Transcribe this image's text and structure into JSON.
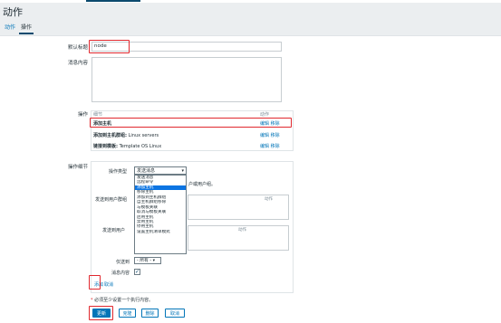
{
  "header": {
    "title": "动作"
  },
  "tabs": [
    {
      "label": "动作"
    },
    {
      "label": "操作"
    }
  ],
  "form": {
    "default_subject_label": "默认标题",
    "default_subject_value": "node",
    "message_label": "消息内容",
    "operations_label": "操作",
    "operation_details_label": "操作细节"
  },
  "operations": {
    "col_detail": "细节",
    "col_action": "动作",
    "rows": [
      {
        "detail": "添加主机",
        "bold": "添加主机",
        "rest": "",
        "edit": "编辑",
        "remove": "移除"
      },
      {
        "detail": "添加到主机群组: Linux servers",
        "bold": "添加到主机群组:",
        "rest": " Linux servers",
        "edit": "编辑",
        "remove": "移除"
      },
      {
        "detail": "链接到模板: Template OS Linux",
        "bold": "链接到模板:",
        "rest": " Template OS Linux",
        "edit": "编辑",
        "remove": "移除"
      }
    ]
  },
  "details": {
    "op_type_label": "操作类型",
    "op_type_value": "发送消息",
    "hint_text": "户或用户组。",
    "send_to_groups_label": "发送到用户群组",
    "groups_action_col": "动作",
    "send_to_users_label": "发送到用户",
    "users_action_col": "动作",
    "only_send_label": "仅送到",
    "only_send_value": "- 所有 -",
    "default_message_label": "消息内容",
    "dropdown_options": [
      "发送消息",
      "远程命令",
      "添加主机",
      "移除主机",
      "添加到主机群组",
      "自主机群组移除",
      "与模板关联",
      "取消与模板关联",
      "启用主机",
      "禁用主机",
      "停用主机",
      "设置主机清单模式"
    ],
    "selected_option": "添加主机",
    "add_link": "添加",
    "cancel_link": "取消"
  },
  "note": {
    "star": "*",
    "text": " 必须至少设置一个执行内容。"
  },
  "buttons": {
    "update": "更新",
    "clone": "克隆",
    "delete": "删除",
    "cancel": "取消"
  },
  "colors": {
    "accent": "#0275b8",
    "highlight": "#e0282e",
    "selected": "#0b74e2"
  }
}
